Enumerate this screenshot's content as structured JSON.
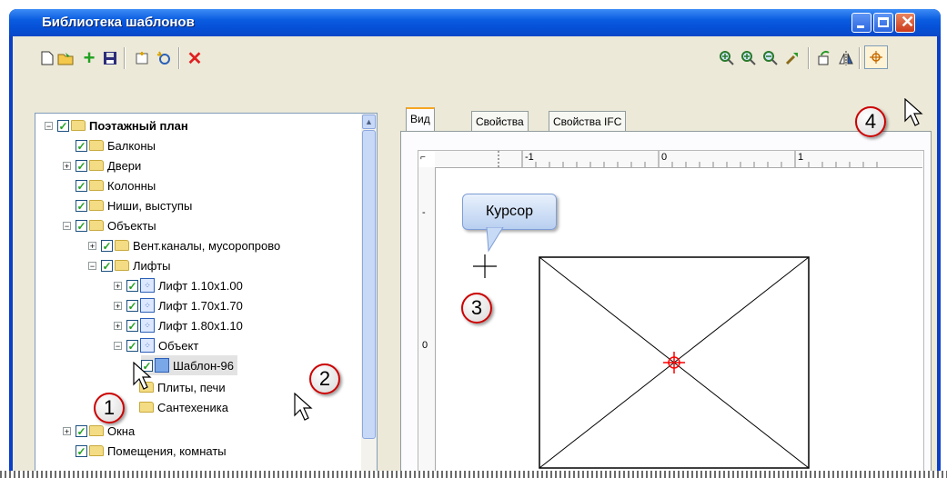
{
  "window": {
    "title": "Библиотека шаблонов"
  },
  "tree": {
    "items": [
      {
        "label": "Поэтажный план",
        "bold": true
      },
      {
        "label": "Балконы"
      },
      {
        "label": "Двери"
      },
      {
        "label": "Колонны"
      },
      {
        "label": "Ниши, выступы"
      },
      {
        "label": "Объекты"
      },
      {
        "label": "Вент.каналы, мусоропрово"
      },
      {
        "label": "Лифты"
      },
      {
        "label": "Лифт 1.10x1.00"
      },
      {
        "label": "Лифт 1.70x1.70"
      },
      {
        "label": "Лифт 1.80x1.10"
      },
      {
        "label": "Объект"
      },
      {
        "label": "Шаблон-96"
      },
      {
        "label": "Плиты, печи"
      },
      {
        "label": "Сантехеника"
      },
      {
        "label": "Окна"
      },
      {
        "label": "Помещения, комнаты"
      }
    ]
  },
  "tabs": [
    "Вид",
    "Свойства",
    "Свойства IFC"
  ],
  "ruler": {
    "h_labels": [
      "-1",
      "0",
      "1"
    ],
    "v_labels": [
      "-",
      "0"
    ]
  },
  "callout": {
    "text": "Курсор"
  },
  "badges": [
    "1",
    "2",
    "3",
    "4"
  ],
  "colors": {
    "accent": "#0a5ce0",
    "badge_border": "#cc0000",
    "crosshair": "#ff0000"
  }
}
